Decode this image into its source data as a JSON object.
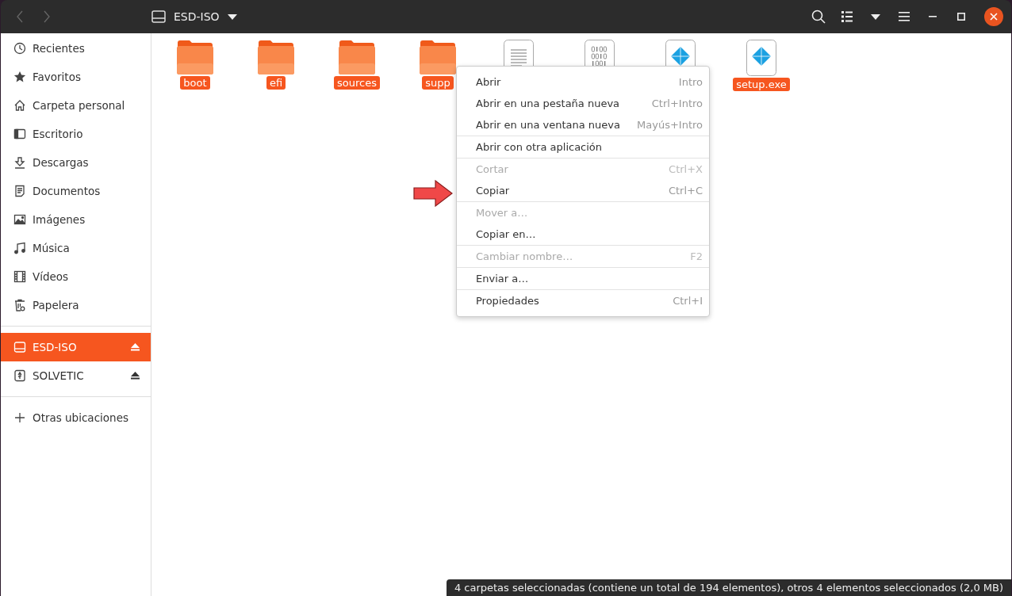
{
  "header": {
    "title": "ESD-ISO"
  },
  "sidebar": {
    "items": [
      {
        "label": "Recientes",
        "kind": "place",
        "selected": false
      },
      {
        "label": "Favoritos",
        "kind": "place",
        "selected": false
      },
      {
        "label": "Carpeta personal",
        "kind": "place",
        "selected": false
      },
      {
        "label": "Escritorio",
        "kind": "place",
        "selected": false
      },
      {
        "label": "Descargas",
        "kind": "place",
        "selected": false
      },
      {
        "label": "Documentos",
        "kind": "place",
        "selected": false
      },
      {
        "label": "Imágenes",
        "kind": "place",
        "selected": false
      },
      {
        "label": "Música",
        "kind": "place",
        "selected": false
      },
      {
        "label": "Vídeos",
        "kind": "place",
        "selected": false
      },
      {
        "label": "Papelera",
        "kind": "place",
        "selected": false
      },
      {
        "label": "ESD-ISO",
        "kind": "device",
        "selected": true
      },
      {
        "label": "SOLVETIC",
        "kind": "device",
        "selected": false
      },
      {
        "label": "Otras ubicaciones",
        "kind": "action",
        "selected": false
      }
    ]
  },
  "files": [
    {
      "kind": "folder",
      "label": "boot",
      "selected": true
    },
    {
      "kind": "folder",
      "label": "efi",
      "selected": true
    },
    {
      "kind": "folder",
      "label": "sources",
      "selected": true
    },
    {
      "kind": "folder",
      "label": "supp",
      "selected": true
    },
    {
      "kind": "text"
    },
    {
      "kind": "binary"
    },
    {
      "kind": "exe"
    },
    {
      "kind": "exe",
      "label": "setup.exe",
      "selected": true
    }
  ],
  "context_menu": {
    "groups": [
      [
        {
          "label": "Abrir",
          "shortcut": "Intro",
          "disabled": false
        },
        {
          "label": "Abrir en una pestaña nueva",
          "shortcut": "Ctrl+Intro",
          "disabled": false
        },
        {
          "label": "Abrir en una ventana nueva",
          "shortcut": "Mayús+Intro",
          "disabled": false
        }
      ],
      [
        {
          "label": "Abrir con otra aplicación",
          "disabled": false
        }
      ],
      [
        {
          "label": "Cortar",
          "shortcut": "Ctrl+X",
          "disabled": true
        },
        {
          "label": "Copiar",
          "shortcut": "Ctrl+C",
          "disabled": false
        }
      ],
      [
        {
          "label": "Mover a…",
          "disabled": true
        },
        {
          "label": "Copiar en…",
          "disabled": false
        }
      ],
      [
        {
          "label": "Cambiar nombre…",
          "shortcut": "F2",
          "disabled": true
        }
      ],
      [
        {
          "label": "Enviar a…",
          "disabled": false
        }
      ],
      [
        {
          "label": "Propiedades",
          "shortcut": "Ctrl+I",
          "disabled": false
        }
      ]
    ]
  },
  "status_bar": "4 carpetas seleccionadas (contiene un total de 194 elementos), otros 4 elementos seleccionados (2,0 MB)"
}
